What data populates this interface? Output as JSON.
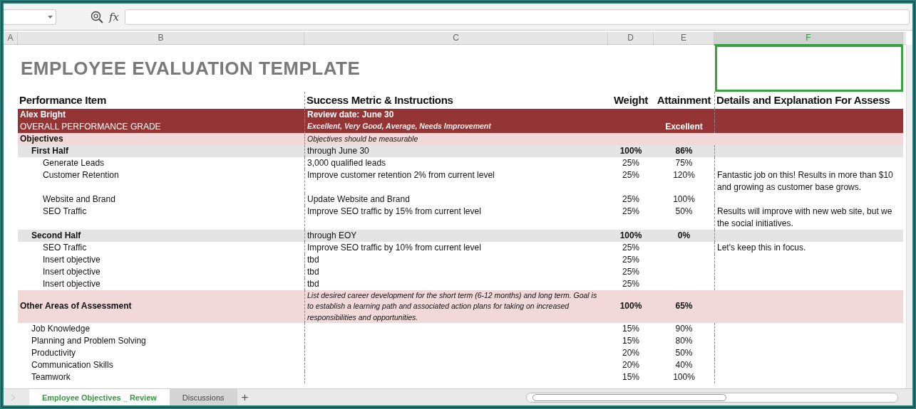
{
  "formula_bar": {
    "function_label": "fx"
  },
  "columns": [
    {
      "label": "A",
      "selected": false
    },
    {
      "label": "B",
      "selected": false
    },
    {
      "label": "C",
      "selected": false
    },
    {
      "label": "D",
      "selected": false
    },
    {
      "label": "E",
      "selected": false
    },
    {
      "label": "F",
      "selected": true
    }
  ],
  "title": "EMPLOYEE EVALUATION TEMPLATE",
  "headers": [
    "Performance Item",
    "Success Metric & Instructions",
    "Weight",
    "Attainment",
    "Details and Explanation For Assess"
  ],
  "employee": {
    "name": "Alex Bright",
    "review_date": "Review date: June 30",
    "grade_label": "OVERALL PERFORMANCE GRADE",
    "grade_options": "Excellent, Very Good, Average, Needs Improvement",
    "grade": "Excellent"
  },
  "sections": [
    {
      "kind": "section",
      "label": "Objectives",
      "metric": "Objectives should be measurable",
      "children": [
        {
          "kind": "group",
          "label": "First Half",
          "metric": "through June 30",
          "weight": "100%",
          "attainment": "86%",
          "children": [
            {
              "kind": "item",
              "label": "Generate Leads",
              "metric": "3,000 qualified leads",
              "weight": "25%",
              "attainment": "75%"
            },
            {
              "kind": "item",
              "label": "Customer Retention",
              "metric": "Improve customer retention 2% from current level",
              "weight": "25%",
              "attainment": "120%",
              "details": "Fantastic job on this! Results in more than $10\nand growing as customer base grows."
            },
            {
              "kind": "item",
              "label": "Website and Brand",
              "metric": "Update Website and Brand",
              "weight": "25%",
              "attainment": "100%"
            },
            {
              "kind": "item",
              "label": "SEO Traffic",
              "metric": "Improve SEO traffic by 15% from current level",
              "weight": "25%",
              "attainment": "50%",
              "details": "Results will improve with new web site, but we\nthe social initiatives."
            }
          ]
        },
        {
          "kind": "group",
          "label": "Second Half",
          "metric": "through EOY",
          "weight": "100%",
          "attainment": "0%",
          "children": [
            {
              "kind": "item",
              "label": "SEO Traffic",
              "metric": "Improve SEO traffic by 10% from current level",
              "weight": "25%",
              "details": "Let's keep this in focus."
            },
            {
              "kind": "item",
              "label": "Insert objective",
              "metric": "tbd",
              "weight": "25%"
            },
            {
              "kind": "item",
              "label": "Insert objective",
              "metric": "tbd",
              "weight": "25%"
            },
            {
              "kind": "item",
              "label": "Insert objective",
              "metric": "tbd",
              "weight": "25%"
            }
          ]
        }
      ]
    },
    {
      "kind": "section",
      "label": "Other Areas of Assessment",
      "metric": "List desired career development for the short term (6-12 months) and long term. Goal is\nto establish a learning path and associated action plans for taking on increased\nresponsibilities and opportunities.",
      "weight": "100%",
      "attainment": "65%",
      "children": [
        {
          "kind": "item",
          "label": "Job Knowledge",
          "weight": "15%",
          "attainment": "90%"
        },
        {
          "kind": "item",
          "label": "Planning and Problem Solving",
          "weight": "15%",
          "attainment": "80%"
        },
        {
          "kind": "item",
          "label": "Productivity",
          "weight": "20%",
          "attainment": "50%"
        },
        {
          "kind": "item",
          "label": "Communication Skills",
          "weight": "20%",
          "attainment": "40%"
        },
        {
          "kind": "item",
          "label": "Teamwork",
          "weight": "15%",
          "attainment": "100%"
        }
      ]
    }
  ],
  "sheet_tabs": [
    {
      "label": "Employee Objectives _ Review",
      "selected": true
    },
    {
      "label": "Discussions",
      "selected": false
    }
  ],
  "new_sheet_label": "+"
}
